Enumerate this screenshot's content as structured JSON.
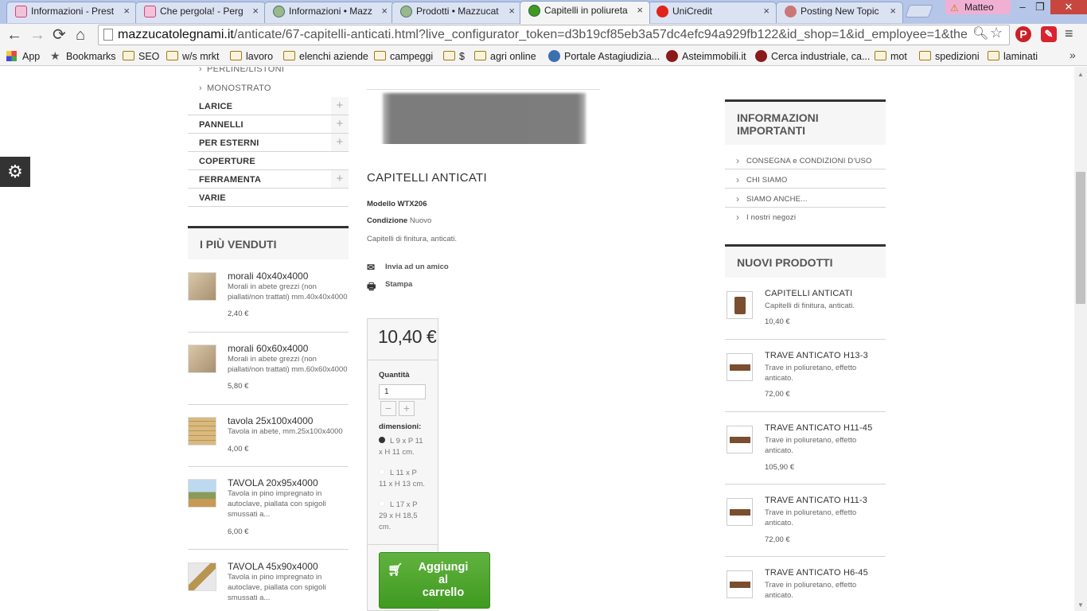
{
  "browser": {
    "tabs": [
      {
        "title": "Informazioni - Prest",
        "active": false
      },
      {
        "title": "Che pergola! - Perg",
        "active": false
      },
      {
        "title": "Informazioni • Mazz",
        "active": false
      },
      {
        "title": "Prodotti • Mazzucat",
        "active": false
      },
      {
        "title": "Capitelli in poliureta",
        "active": true
      },
      {
        "title": "UniCredit",
        "active": false
      },
      {
        "title": "Posting New Topic",
        "active": false
      }
    ],
    "tab_close": "×",
    "profile_name": "Matteo",
    "window_buttons": {
      "minimize": "‒",
      "maximize": "❐",
      "close": "✕"
    },
    "nav": {
      "back": "←",
      "forward": "→",
      "reload": "⟳",
      "home": "⌂"
    },
    "url_host": "mazzucatolegnami.it",
    "url_path": "/anticate/67-capitelli-anticati.html?live_configurator_token=d3b19cf85eb3a57dc4efc94a929fb122&id_shop=1&id_employee=1&the",
    "menu_icon": "≡",
    "bookmarks": [
      {
        "label": "App",
        "type": "apps"
      },
      {
        "label": "Bookmarks",
        "type": "star"
      },
      {
        "label": "SEO",
        "type": "folder"
      },
      {
        "label": "w/s mrkt",
        "type": "folder"
      },
      {
        "label": "lavoro",
        "type": "folder"
      },
      {
        "label": "elenchi aziende",
        "type": "folder"
      },
      {
        "label": "campeggi",
        "type": "folder"
      },
      {
        "label": "$",
        "type": "folder"
      },
      {
        "label": "agri online",
        "type": "folder"
      },
      {
        "label": "Portale Astagiudizia...",
        "type": "site"
      },
      {
        "label": "Asteimmobili.it",
        "type": "site"
      },
      {
        "label": "Cerca industriale, ca...",
        "type": "site"
      },
      {
        "label": "mot",
        "type": "folder"
      },
      {
        "label": "spedizioni",
        "type": "folder"
      },
      {
        "label": "laminati",
        "type": "folder"
      }
    ],
    "bookmarks_more": "»"
  },
  "sidebar_left": {
    "subcategories": [
      "PERLINE/LISTONI",
      "MONOSTRATO"
    ],
    "categories": [
      {
        "label": "LARICE",
        "expandable": true
      },
      {
        "label": "PANNELLI",
        "expandable": true
      },
      {
        "label": "PER ESTERNI",
        "expandable": true
      },
      {
        "label": "COPERTURE",
        "expandable": false
      },
      {
        "label": "FERRAMENTA",
        "expandable": true
      },
      {
        "label": "VARIE",
        "expandable": false
      }
    ],
    "expand_symbol": "+",
    "bestsellers_title": "I PIÙ VENDUTI",
    "bestsellers": [
      {
        "name": "morali 40x40x4000",
        "desc": "Morali in abete grezzi (non piallati/non trattati) mm.40x40x4000",
        "price": "2,40 €"
      },
      {
        "name": "morali 60x60x4000",
        "desc": "Morali in abete grezzi (non piallati/non trattati) mm.60x60x4000",
        "price": "5,80 €"
      },
      {
        "name": "tavola 25x100x4000",
        "desc": "Tavola in abete, mm.25x100x4000",
        "price": "4,00 €"
      },
      {
        "name": "TAVOLA 20x95x4000",
        "desc": "Tavola in pino impregnato in autoclave, piallata con spigoli smussati a...",
        "price": "6,00 €"
      },
      {
        "name": "TAVOLA 45x90x4000",
        "desc": "Tavola in pino impregnato in autoclave, piallata con spigoli smussati a...",
        "price": ""
      }
    ]
  },
  "product": {
    "title": "CAPITELLI ANTICATI",
    "model_label": "Modello",
    "model_value": "WTX206",
    "condition_label": "Condizione",
    "condition_value": "Nuovo",
    "short_desc": "Capitelli di finitura, anticati.",
    "send_friend": "Invia ad un amico",
    "print": "Stampa",
    "price": "10,40 €",
    "quantity_label": "Quantità",
    "quantity_value": "1",
    "qty_minus": "−",
    "qty_plus": "+",
    "dimensions_label": "dimensioni:",
    "dimension_options": [
      {
        "label": "L 9 x P 11 x H 11 cm.",
        "selected": true
      },
      {
        "label": "L 11 x P 11 x H 13 cm.",
        "selected": false
      },
      {
        "label": "L 17 x P 29 x H 18,5 cm.",
        "selected": false
      }
    ],
    "add_to_cart": "Aggiungi\nal\ncarrello"
  },
  "sidebar_right": {
    "info_title": "INFORMAZIONI IMPORTANTI",
    "info_links": [
      "CONSEGNA e CONDIZIONI D'USO",
      "CHI SIAMO",
      "SIAMO ANCHE...",
      "I nostri negozi"
    ],
    "new_products_title": "NUOVI PRODOTTI",
    "new_products": [
      {
        "name": "CAPITELLI ANTICATI",
        "desc": "Capitelli di finitura, anticati.",
        "price": "10,40 €"
      },
      {
        "name": "TRAVE ANTICATO H13-3",
        "desc": "Trave in poliuretano, effetto anticato.",
        "price": "72,00 €"
      },
      {
        "name": "TRAVE ANTICATO H11-45",
        "desc": "Trave in poliuretano, effetto anticato.",
        "price": "105,90 €"
      },
      {
        "name": "TRAVE ANTICATO H11-3",
        "desc": "Trave in poliuretano, effetto anticato.",
        "price": "72,00 €"
      },
      {
        "name": "TRAVE ANTICATO H6-45",
        "desc": "Trave in poliuretano, effetto anticato.",
        "price": ""
      }
    ]
  },
  "colors": {
    "accent_green": "#4fa32f",
    "block_border": "#333333"
  }
}
